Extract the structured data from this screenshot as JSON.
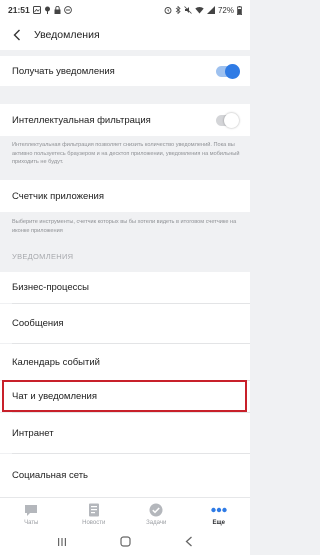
{
  "status_bar": {
    "time": "21:51",
    "battery": "72%"
  },
  "header": {
    "title": "Уведомления"
  },
  "rows": {
    "receive": "Получать уведомления",
    "smart_filter": "Интеллектуальная фильтрация",
    "smart_filter_desc": "Интеллектуальная фильтрация позволяет снизить количество уведомлений. Пока вы активно пользуетесь браузером и на десктоп приложении, уведомления на мобильный приходить не будут.",
    "counter": "Счетчик приложения",
    "counter_desc": "Выберите инструменты, счетчик которых вы бы хотели видеть в итоговом счетчике на иконке приложения",
    "section": "УВЕДОМЛЕНИЯ",
    "items": [
      "Бизнес-процессы",
      "Сообщения",
      "Календарь событий",
      "Чат и уведомления",
      "Интранет",
      "Социальная сеть"
    ]
  },
  "toggles": {
    "receive": true,
    "smart_filter": false
  },
  "tabs": [
    {
      "label": "Чаты",
      "icon": "chat-icon",
      "active": false
    },
    {
      "label": "Новости",
      "icon": "news-icon",
      "active": false
    },
    {
      "label": "Задачи",
      "icon": "check-icon",
      "active": false
    },
    {
      "label": "Еще",
      "icon": "more-icon",
      "active": true
    }
  ],
  "colors": {
    "accent": "#2f7be5",
    "highlight": "#c8202a",
    "background": "#f0f1f3"
  }
}
